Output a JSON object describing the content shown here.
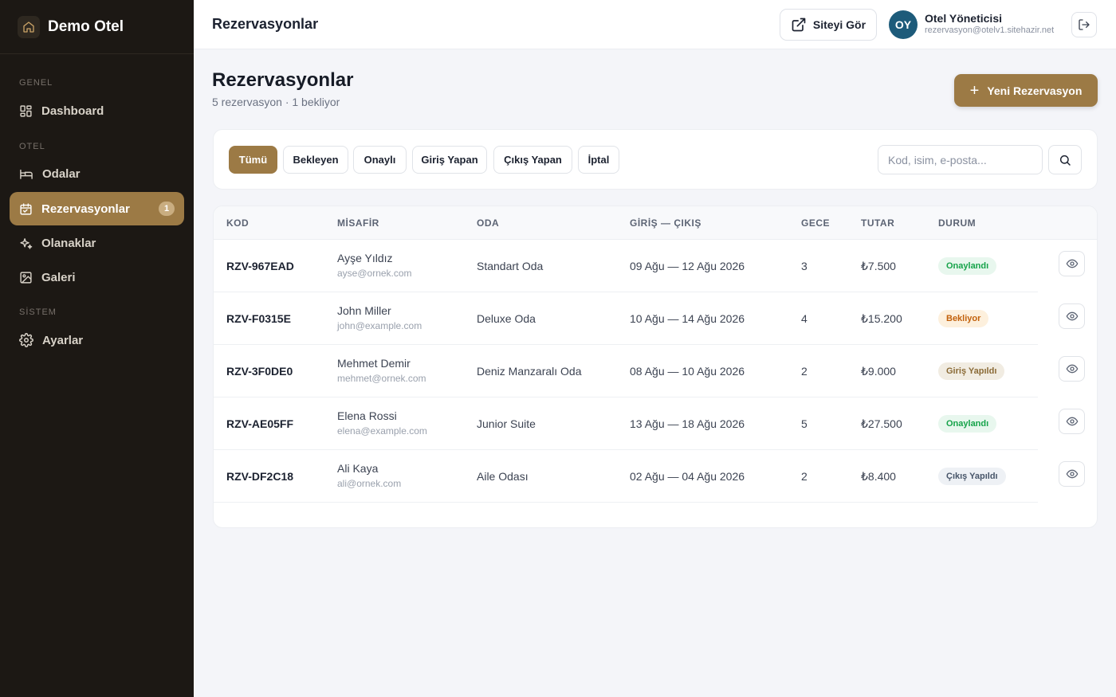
{
  "sidebar": {
    "brand": "Demo Otel",
    "sections": {
      "general": "GENEL",
      "hotel": "OTEL",
      "system": "SİSTEM"
    },
    "items": {
      "dashboard": "Dashboard",
      "rooms": "Odalar",
      "reservations": "Rezervasyonlar",
      "reservations_badge": "1",
      "amenities": "Olanaklar",
      "gallery": "Galeri",
      "settings": "Ayarlar"
    }
  },
  "topbar": {
    "title": "Rezervasyonlar",
    "view_site": "Siteyi Gör",
    "user": {
      "initials": "OY",
      "name": "Otel Yöneticisi",
      "email": "rezervasyon@otelv1.sitehazir.net"
    }
  },
  "page": {
    "title": "Rezervasyonlar",
    "subtitle": "5 rezervasyon · 1 bekliyor",
    "new_button": "Yeni Rezervasyon"
  },
  "filters": {
    "all": "Tümü",
    "pending": "Bekleyen",
    "confirmed": "Onaylı",
    "checked_in": "Giriş Yapan",
    "checked_out": "Çıkış Yapan",
    "cancelled": "İptal"
  },
  "search": {
    "placeholder": "Kod, isim, e-posta..."
  },
  "table": {
    "headers": {
      "code": "KOD",
      "guest": "MİSAFİR",
      "room": "ODA",
      "dates": "GİRİŞ — ÇIKIŞ",
      "nights": "GECE",
      "amount": "TUTAR",
      "status": "DURUM"
    },
    "rows": [
      {
        "code": "RZV-967EAD",
        "name": "Ayşe Yıldız",
        "email": "ayse@ornek.com",
        "room": "Standart Oda",
        "dates": "09 Ağu — 12 Ağu 2026",
        "nights": "3",
        "amount": "₺7.500",
        "status": "Onaylandı"
      },
      {
        "code": "RZV-F0315E",
        "name": "John Miller",
        "email": "john@example.com",
        "room": "Deluxe Oda",
        "dates": "10 Ağu — 14 Ağu 2026",
        "nights": "4",
        "amount": "₺15.200",
        "status": "Bekliyor"
      },
      {
        "code": "RZV-3F0DE0",
        "name": "Mehmet Demir",
        "email": "mehmet@ornek.com",
        "room": "Deniz Manzaralı Oda",
        "dates": "08 Ağu — 10 Ağu 2026",
        "nights": "2",
        "amount": "₺9.000",
        "status": "Giriş Yapıldı"
      },
      {
        "code": "RZV-AE05FF",
        "name": "Elena Rossi",
        "email": "elena@example.com",
        "room": "Junior Suite",
        "dates": "13 Ağu — 18 Ağu 2026",
        "nights": "5",
        "amount": "₺27.500",
        "status": "Onaylandı"
      },
      {
        "code": "RZV-DF2C18",
        "name": "Ali Kaya",
        "email": "ali@ornek.com",
        "room": "Aile Odası",
        "dates": "02 Ağu — 04 Ağu 2026",
        "nights": "2",
        "amount": "₺8.400",
        "status": "Çıkış Yapıldı"
      }
    ]
  },
  "colors": {
    "accent": "#9c7a45",
    "sidebar_bg": "#1c1814",
    "avatar_bg": "#1d5b7a",
    "status_confirmed": "#16a34a",
    "status_pending": "#c2610c",
    "status_checked_in": "#8a6a36",
    "status_checked_out": "#475569"
  }
}
